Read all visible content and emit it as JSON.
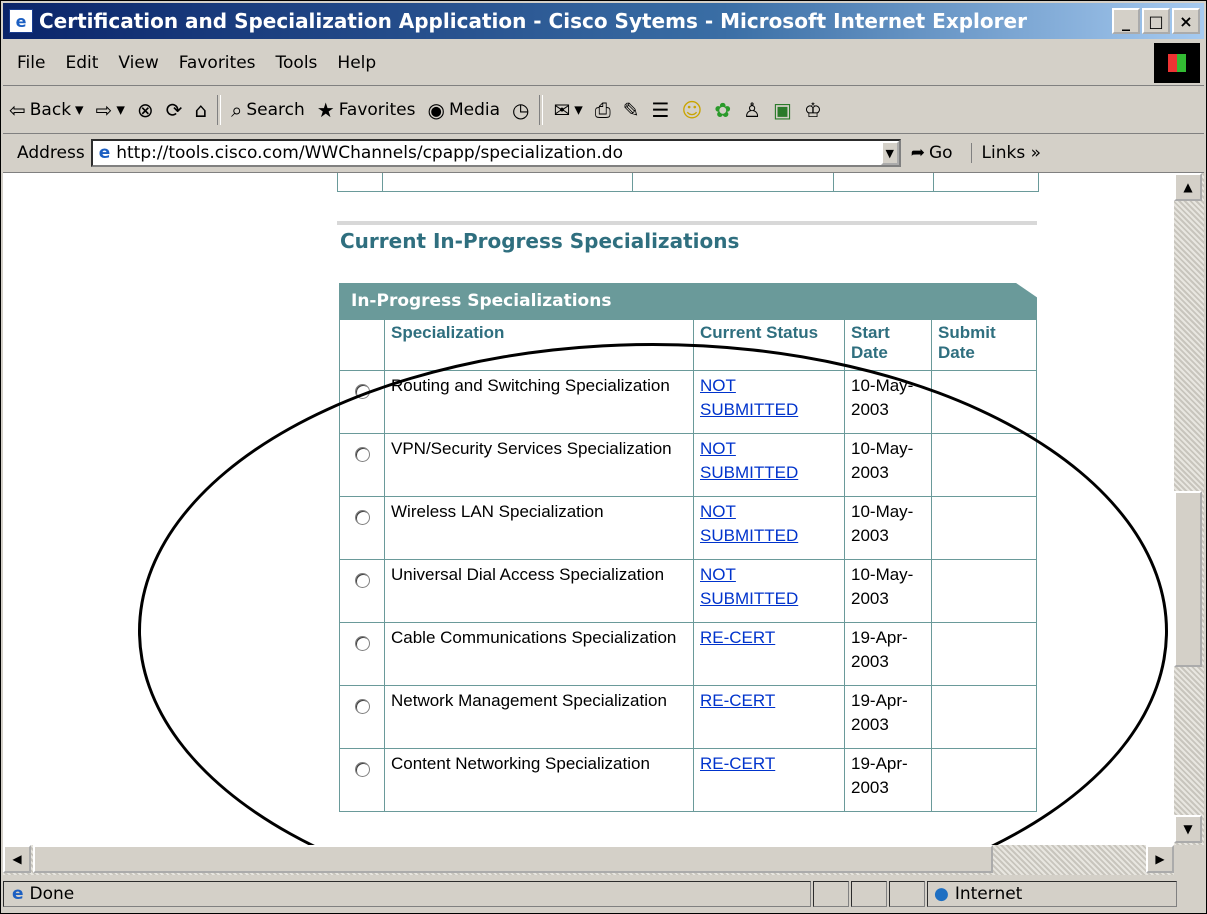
{
  "window": {
    "title": "Certification and Specialization Application - Cisco Sytems - Microsoft Internet Explorer",
    "controls": [
      "_",
      "□",
      "×"
    ]
  },
  "menu": [
    "File",
    "Edit",
    "View",
    "Favorites",
    "Tools",
    "Help"
  ],
  "toolbar": {
    "back": "Back",
    "search": "Search",
    "favorites": "Favorites",
    "media": "Media"
  },
  "address": {
    "label": "Address",
    "url": "http://tools.cisco.com/WWChannels/cpapp/specialization.do",
    "go": "Go",
    "links": "Links"
  },
  "page": {
    "section_title": "Current In-Progress Specializations",
    "panel_title": "In-Progress Specializations",
    "columns": [
      "Specialization",
      "Current Status",
      "Start Date",
      "Submit Date"
    ],
    "rows": [
      {
        "name": "Routing and Switching Specialization",
        "status": "NOT SUBMITTED",
        "start": "10-May-2003",
        "submit": ""
      },
      {
        "name": "VPN/Security Services Specialization",
        "status": "NOT SUBMITTED",
        "start": "10-May-2003",
        "submit": ""
      },
      {
        "name": "Wireless LAN Specialization",
        "status": "NOT SUBMITTED",
        "start": "10-May-2003",
        "submit": ""
      },
      {
        "name": "Universal Dial Access Specialization",
        "status": "NOT SUBMITTED",
        "start": "10-May-2003",
        "submit": ""
      },
      {
        "name": "Cable Communications Specialization",
        "status": "RE-CERT",
        "start": "19-Apr-2003",
        "submit": ""
      },
      {
        "name": "Network Management Specialization",
        "status": "RE-CERT",
        "start": "19-Apr-2003",
        "submit": ""
      },
      {
        "name": "Content Networking Specialization",
        "status": "RE-CERT",
        "start": "19-Apr-2003",
        "submit": ""
      }
    ]
  },
  "status": {
    "text": "Done",
    "zone": "Internet"
  }
}
